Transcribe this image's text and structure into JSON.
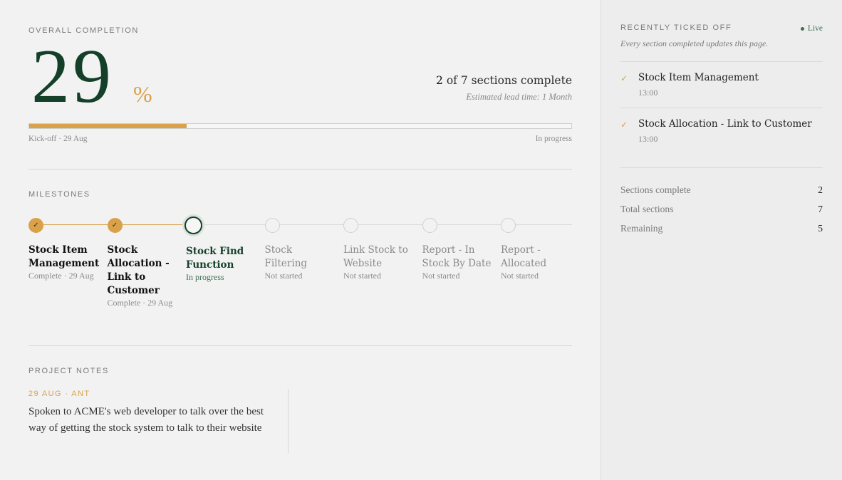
{
  "overall": {
    "label": "OVERALL COMPLETION",
    "percent": "29",
    "percent_sign": "%",
    "progress": 0.29,
    "sections_done": "2",
    "sections_text": " of 7 sections complete",
    "lead_time": "Estimated lead time: 1 Month",
    "start_label": "Kick-off · 29 Aug",
    "status_label": "In progress"
  },
  "milestones": {
    "label": "MILESTONES",
    "items": [
      {
        "title": "Stock Item Management",
        "status": "Complete · 29 Aug",
        "state": "done"
      },
      {
        "title": "Stock Allocation - Link to Customer",
        "status": "Complete · 29 Aug",
        "state": "done"
      },
      {
        "title": "Stock Find Function",
        "status": "In progress",
        "state": "current"
      },
      {
        "title": "Stock Filtering",
        "status": "Not started",
        "state": "not-started"
      },
      {
        "title": "Link Stock to Website",
        "status": "Not started",
        "state": "not-started"
      },
      {
        "title": "Report - In Stock By Date",
        "status": "Not started",
        "state": "not-started"
      },
      {
        "title": "Report - Allocated",
        "status": "Not started",
        "state": "not-started"
      }
    ]
  },
  "notes": {
    "label": "PROJECT NOTES",
    "items": [
      {
        "meta": "29 AUG · ANT",
        "body": "Spoken to ACME's web developer to talk over the best way of getting the stock system to talk to their website"
      }
    ]
  },
  "sidebar": {
    "label": "RECENTLY TICKED OFF",
    "live": "Live",
    "subtitle": "Every section completed updates this page.",
    "ticked": [
      {
        "title": "Stock Item Management",
        "time": "13:00"
      },
      {
        "title": "Stock Allocation - Link to Customer",
        "time": "13:00"
      }
    ],
    "stats": [
      {
        "label": "Sections complete",
        "value": "2"
      },
      {
        "label": "Total sections",
        "value": "7"
      },
      {
        "label": "Remaining",
        "value": "5"
      }
    ]
  },
  "colors": {
    "accent": "#d9a14a",
    "brand": "#14402a",
    "live": "#3f6f55"
  },
  "icons": {
    "done": "check-icon",
    "ticked": "tick-icon",
    "live": "live-dot-icon"
  }
}
